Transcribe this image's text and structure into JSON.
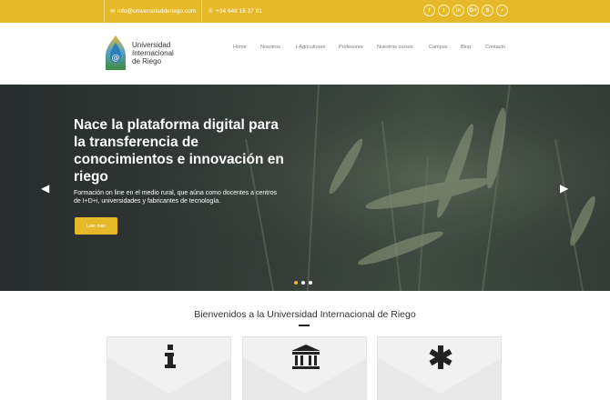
{
  "topbar": {
    "email": "info@universidadderiego.com",
    "phone": "+34 648 16 37 81",
    "socials": [
      {
        "icon": "facebook-icon",
        "glyph": "f"
      },
      {
        "icon": "twitter-icon",
        "glyph": "t"
      },
      {
        "icon": "linkedin-icon",
        "glyph": "in"
      },
      {
        "icon": "google-plus-icon",
        "glyph": "G+"
      },
      {
        "icon": "skype-icon",
        "glyph": "S"
      },
      {
        "icon": "user-icon",
        "glyph": "•"
      }
    ]
  },
  "logo": {
    "line1": "Universidad",
    "line2": "Internacional",
    "line3": "de Riego"
  },
  "nav": {
    "items": [
      "Home",
      "Nosotros",
      "I-Agricultores",
      "Profesores",
      "Nuestros cursos",
      "Campus",
      "Blog",
      "Contacto"
    ]
  },
  "hero": {
    "title": "Nace la plataforma digital para la transferencia de conocimientos e innovación en riego",
    "subtitle": "Formación on line en el medio rural, que aúna como docentes a centros de I+D+i, universidades y fabricantes de tecnología.",
    "button": "Leer mas",
    "slides": 3,
    "active_slide": 1
  },
  "welcome": {
    "title": "Bienvenidos a la Universidad Internacional de Riego"
  },
  "cards": [
    {
      "icon": "info-icon"
    },
    {
      "icon": "institution-icon"
    },
    {
      "icon": "asterisk-icon"
    }
  ],
  "colors": {
    "accent": "#e6b92a",
    "text": "#333333",
    "nav_text": "#777777"
  }
}
